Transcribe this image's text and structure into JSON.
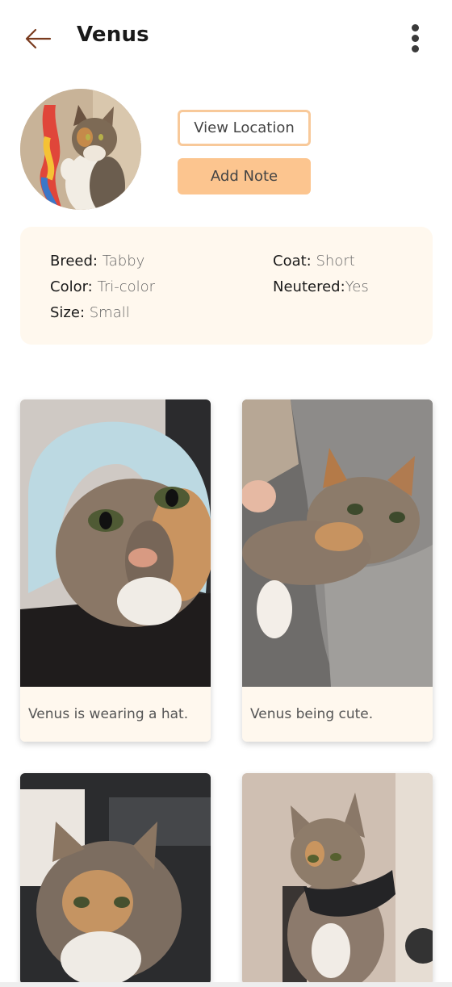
{
  "header": {
    "title": "Venus"
  },
  "profile": {
    "view_location_label": "View Location",
    "add_note_label": "Add Note"
  },
  "details": {
    "breed": {
      "label": "Breed:",
      "value": "Tabby"
    },
    "coat": {
      "label": "Coat:",
      "value": "Short"
    },
    "color": {
      "label": "Color:",
      "value": "Tri-color"
    },
    "neutered": {
      "label": "Neutered:",
      "value": "Yes"
    },
    "size": {
      "label": "Size:",
      "value": "Small"
    }
  },
  "photos": [
    {
      "caption": "Venus is wearing a hat."
    },
    {
      "caption": "Venus being cute."
    }
  ],
  "colors": {
    "accent": "#fcc58f",
    "accent_border": "#f8c99a",
    "card_bg": "#fff8ee",
    "back_arrow": "#7a3b1e"
  },
  "icons": {
    "back": "back-arrow-icon",
    "menu": "more-vertical-icon"
  }
}
